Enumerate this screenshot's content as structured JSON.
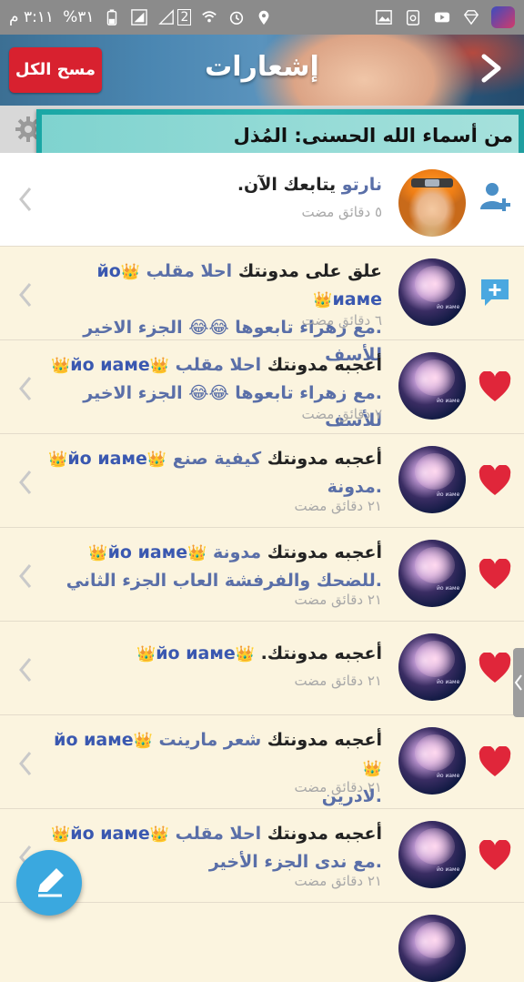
{
  "status_bar": {
    "time": "٣:١١ م",
    "battery": "%٣١",
    "sim": "2"
  },
  "header": {
    "title": "إشعارات",
    "clear_all": "مسح الكل"
  },
  "banner": {
    "text": "من أسماء الله الحسنى: المُذل"
  },
  "notifications": [
    {
      "type": "follow",
      "user": "نارتو",
      "action": "يتابعك الآن.",
      "time": "٥ دقائق مضت"
    },
    {
      "type": "comment",
      "line1": "علق على مدونتك",
      "target": "احلا مقلب",
      "user": "йо иаме",
      "line2": ".مع زهراء تابعوها 😂😂 الجزء الاخير للأسف",
      "time": "٦ دقائق مضت"
    },
    {
      "type": "like",
      "line1": "أعجبه مدونتك",
      "target": "احلا مقلب",
      "user": "йо иаме",
      "line2": ".مع زهراء تابعوها 😂😂 الجزء الاخير للأسف",
      "time": "٧ دقائق مضت"
    },
    {
      "type": "like",
      "line1": "أعجبه مدونتك",
      "target": "كيفية صنع",
      "user": "йо иаме",
      "line2": ".مدونة",
      "time": "٢١ دقائق مضت"
    },
    {
      "type": "like",
      "line1": "أعجبه مدونتك",
      "target": "مدونة",
      "user": "йо иаме",
      "line2": ".للضحك والفرفشة العاب الجزء الثاني",
      "time": "٢١ دقائق مضت"
    },
    {
      "type": "like",
      "line1": "أعجبه مدونتك.",
      "target": "",
      "user": "йо иаме",
      "line2": "",
      "time": "٢١ دقائق مضت"
    },
    {
      "type": "like",
      "line1": "أعجبه مدونتك",
      "target": "شعر مارينت",
      "user": "йо иаме",
      "line2": ".لادرين",
      "time": "٢١ دقائق مضت"
    },
    {
      "type": "like",
      "line1": "أعجبه مدونتك",
      "target": "احلا مقلب",
      "user": "йо иаме",
      "line2": ".مع ندى الجزء الأخير",
      "time": "٢١ دقائق مضت"
    }
  ],
  "colors": {
    "header_accent": "#d8212f",
    "like_heart": "#e0263a",
    "comment_icon": "#4aa8e0",
    "follow_icon": "#4a8fc7",
    "list_bg": "#fbf4df",
    "fab": "#3aa8df"
  },
  "crown_symbol": "👑"
}
